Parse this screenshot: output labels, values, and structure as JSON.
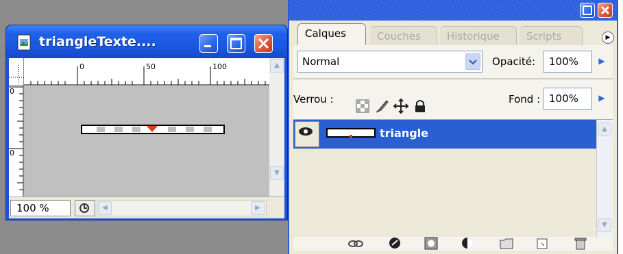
{
  "doc_window": {
    "title": "triangleTexte....",
    "zoom": "100 %",
    "ruler_h_labels": [
      "0",
      "50",
      "100"
    ],
    "ruler_v_labels": [
      "0",
      "0"
    ]
  },
  "layers_panel": {
    "tabs": [
      {
        "label": "Calques",
        "active": true
      },
      {
        "label": "Couches",
        "active": false
      },
      {
        "label": "Historique",
        "active": false
      },
      {
        "label": "Scripts",
        "active": false
      }
    ],
    "blend_mode": "Normal",
    "opacity_label": "Opacité:",
    "opacity_value": "100%",
    "lock_label": "Verrou :",
    "fill_label": "Fond :",
    "fill_value": "100%",
    "layers": [
      {
        "name": "triangle",
        "selected": true,
        "visible": true
      }
    ],
    "bottom_icons": [
      "link-icon",
      "layer-style-icon",
      "mask-icon",
      "adjustment-layer-icon",
      "new-group-icon",
      "new-layer-icon",
      "delete-layer-icon"
    ]
  },
  "colors": {
    "xp_blue": "#1e52d8",
    "selection": "#2a5fd2",
    "panel_bg": "#ece9d8",
    "close_red": "#e0593a",
    "triangle": "#e03a1a"
  }
}
